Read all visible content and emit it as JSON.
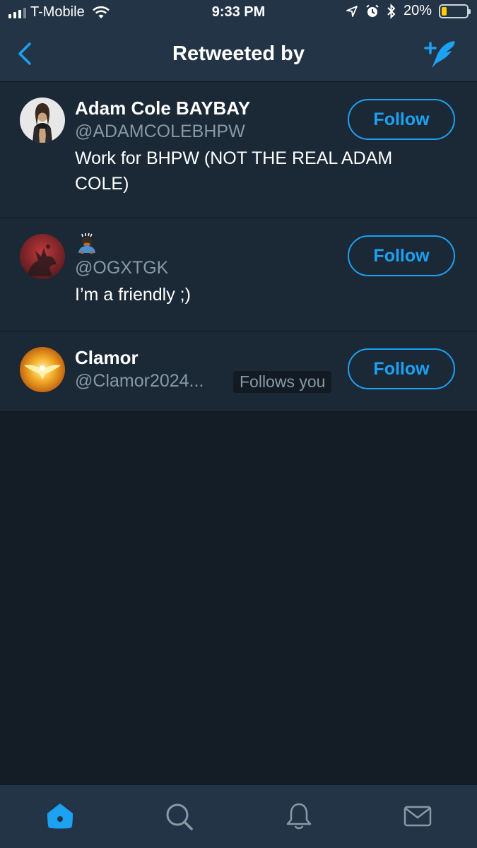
{
  "status_bar": {
    "carrier": "T-Mobile",
    "time": "9:33 PM",
    "battery_percent": "20%",
    "battery_level": 0.2,
    "signal_bars": 3
  },
  "nav": {
    "title": "Retweeted by",
    "back_icon": "chevron-left-icon",
    "compose_icon": "compose-feather-icon"
  },
  "users": [
    {
      "name": "Adam Cole BAYBAY",
      "handle": "@ADAMCOLEBHPW",
      "bio": "Work for BHPW (NOT THE REAL ADAM COLE)",
      "follow_label": "Follow"
    },
    {
      "name": "🙇🏽",
      "handle": "@OGXTGK",
      "bio": "I’m a friendly ;)",
      "follow_label": "Follow"
    },
    {
      "name": "Clamor",
      "handle": "@Clamor2024...",
      "badge": "Follows you",
      "follow_label": "Follow"
    }
  ],
  "tabs": [
    "home-icon",
    "search-icon",
    "notifications-bell-icon",
    "messages-envelope-icon"
  ],
  "colors": {
    "accent": "#1da1f2",
    "background": "#141d26",
    "row_background": "#1b2836",
    "bar_background": "#243447",
    "secondary_text": "#8899a6"
  }
}
